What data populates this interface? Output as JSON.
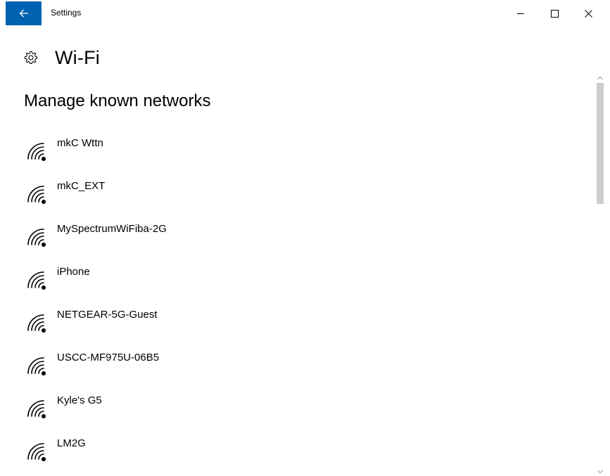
{
  "window": {
    "title": "Settings",
    "accent_color": "#0063b1",
    "controls": [
      "minimize-icon",
      "maximize-icon",
      "close-icon"
    ]
  },
  "page": {
    "icon": "gear-icon",
    "title": "Wi-Fi"
  },
  "section": {
    "title": "Manage known networks"
  },
  "networks": [
    {
      "name": "mkC Wttn",
      "icon": "wifi-icon"
    },
    {
      "name": "mkC_EXT",
      "icon": "wifi-icon"
    },
    {
      "name": "MySpectrumWiFiba-2G",
      "icon": "wifi-icon"
    },
    {
      "name": "iPhone",
      "icon": "wifi-icon"
    },
    {
      "name": "NETGEAR-5G-Guest",
      "icon": "wifi-icon"
    },
    {
      "name": "USCC-MF975U-06B5",
      "icon": "wifi-icon"
    },
    {
      "name": "Kyle's G5",
      "icon": "wifi-icon"
    },
    {
      "name": "LM2G",
      "icon": "wifi-icon"
    }
  ]
}
